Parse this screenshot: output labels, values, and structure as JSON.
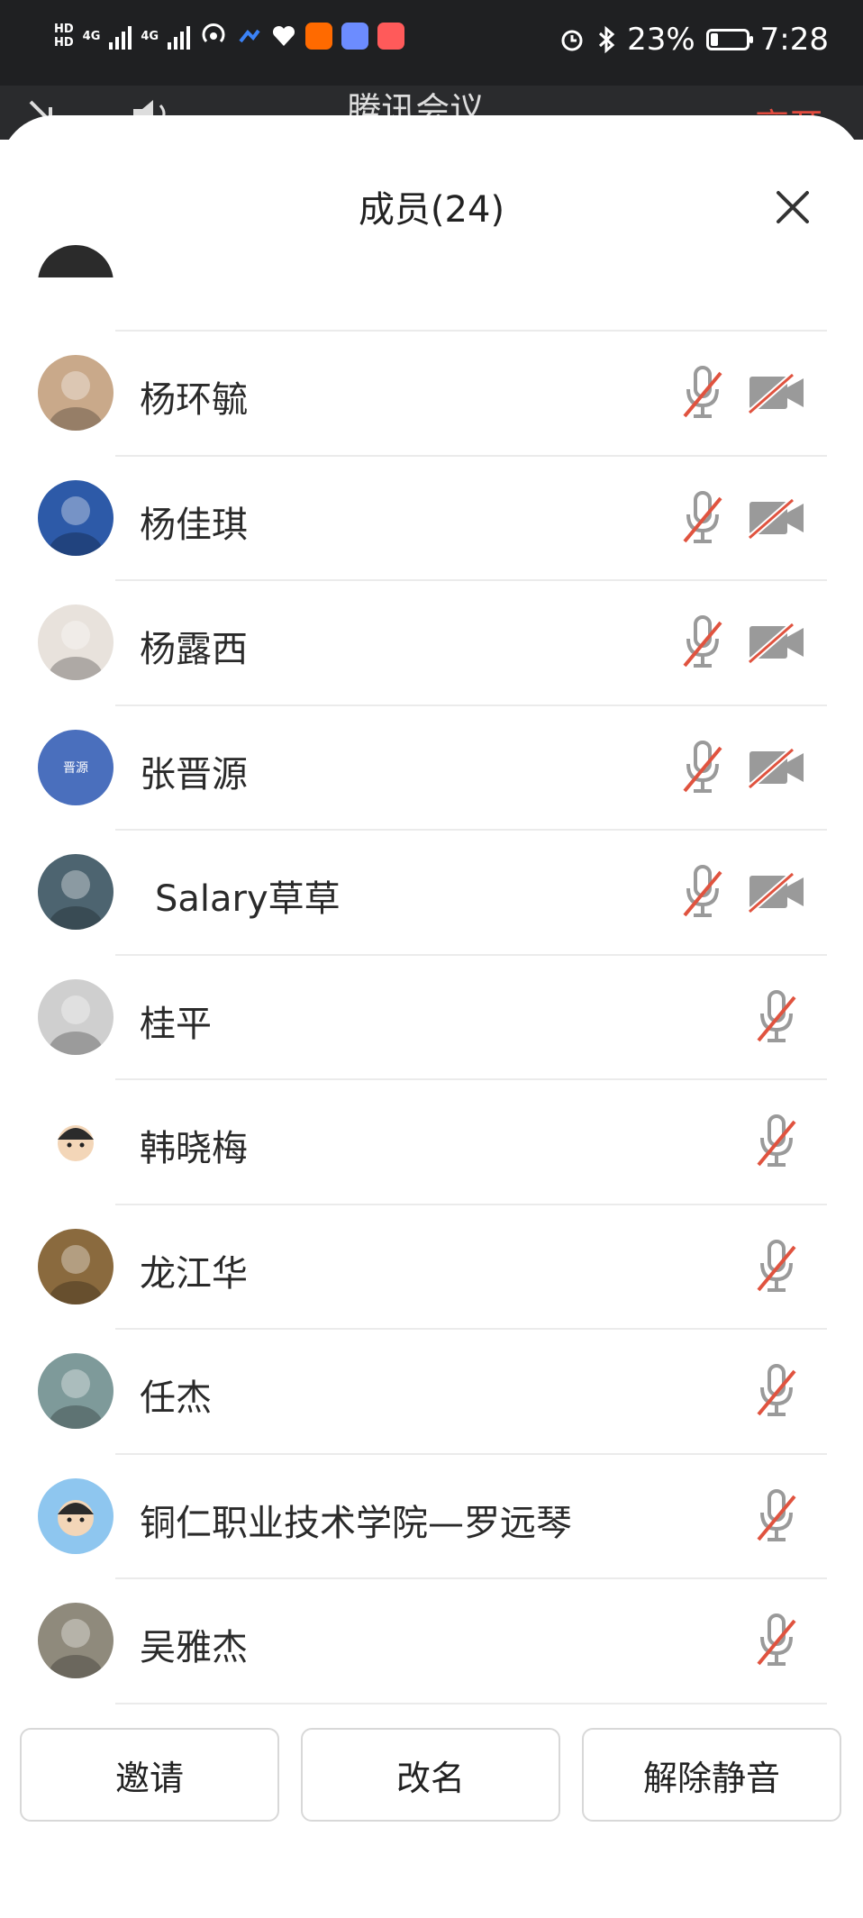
{
  "status_bar": {
    "battery_percent_text": "23%",
    "battery_level": 0.23,
    "time": "7:28",
    "network_1": "4G",
    "network_2": "4G",
    "hd_label": "HD"
  },
  "meeting_header": {
    "title": "腾讯会议",
    "leave_label": "离开"
  },
  "panel": {
    "title": "成员(24)",
    "close_icon": "close-icon"
  },
  "members": [
    {
      "name": "杨环毓",
      "mic_muted": true,
      "camera_off": true,
      "avatar": "photo",
      "avatar_color": "#c9a98a"
    },
    {
      "name": "杨佳琪",
      "mic_muted": true,
      "camera_off": true,
      "avatar": "photo",
      "avatar_color": "#2d5aa8"
    },
    {
      "name": "杨露西",
      "mic_muted": true,
      "camera_off": true,
      "avatar": "photo",
      "avatar_color": "#e8e2dc"
    },
    {
      "name": "张晋源",
      "mic_muted": true,
      "camera_off": true,
      "avatar": "initials",
      "avatar_text": "晋源",
      "avatar_color": "#4a6fbd"
    },
    {
      "name": "Salary草草",
      "mic_muted": true,
      "camera_off": true,
      "avatar": "photo",
      "avatar_color": "#4d6470"
    },
    {
      "name": "桂平",
      "mic_muted": true,
      "camera_off": null,
      "avatar": "photo",
      "avatar_color": "#cfcfcf"
    },
    {
      "name": "韩晓梅",
      "mic_muted": true,
      "camera_off": null,
      "avatar": "cartoon",
      "avatar_color": "#ffffff"
    },
    {
      "name": "龙江华",
      "mic_muted": true,
      "camera_off": null,
      "avatar": "photo",
      "avatar_color": "#8a6a3e"
    },
    {
      "name": "任杰",
      "mic_muted": true,
      "camera_off": null,
      "avatar": "photo",
      "avatar_color": "#7e9a9a"
    },
    {
      "name": "铜仁职业技术学院—罗远琴",
      "mic_muted": true,
      "camera_off": null,
      "avatar": "cartoon",
      "avatar_color": "#8ec6ef"
    },
    {
      "name": "吴雅杰",
      "mic_muted": true,
      "camera_off": null,
      "avatar": "photo",
      "avatar_color": "#8f8a7c"
    }
  ],
  "footer": {
    "invite_label": "邀请",
    "rename_label": "改名",
    "unmute_label": "解除静音"
  },
  "colors": {
    "icon_grey": "#9a9a9a",
    "slash_red": "#e0533f",
    "separator": "#ebebeb",
    "leave_red": "#e34b3e"
  }
}
